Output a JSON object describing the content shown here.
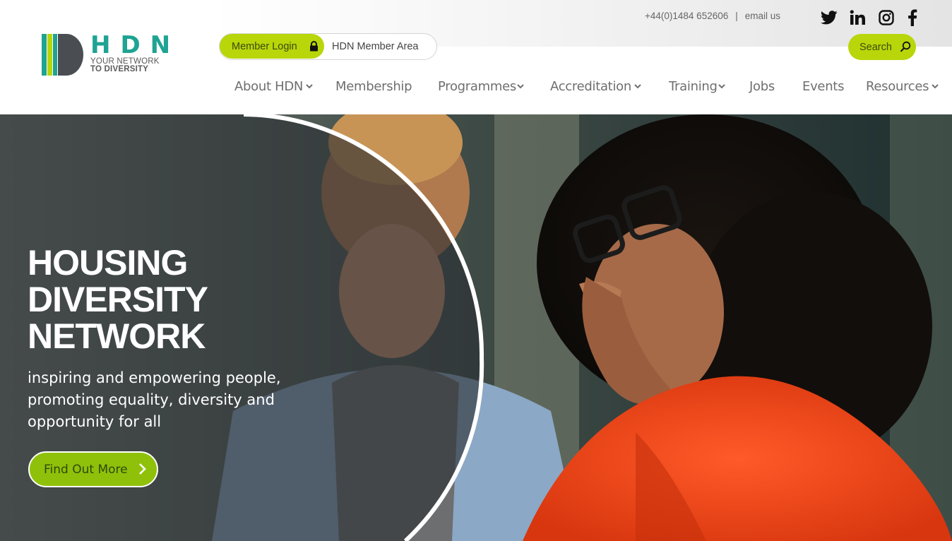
{
  "brand": {
    "letters": "HDN",
    "tagline_line1": "YOUR NETWORK",
    "tagline_line2": "TO DIVERSITY"
  },
  "topbar": {
    "phone": "+44(0)1484 652606",
    "separator": "|",
    "email": "email us",
    "socials": [
      "twitter-icon",
      "linkedin-icon",
      "instagram-icon",
      "facebook-icon"
    ]
  },
  "member": {
    "login_label": "Member Login",
    "area_label": "HDN Member Area"
  },
  "search": {
    "label": "Search"
  },
  "nav": {
    "items": [
      {
        "label": "About HDN",
        "dropdown": true
      },
      {
        "label": "Membership",
        "dropdown": false
      },
      {
        "label": "Programmes",
        "dropdown": true
      },
      {
        "label": "Accreditation",
        "dropdown": true
      },
      {
        "label": "Training",
        "dropdown": true
      },
      {
        "label": "Jobs",
        "dropdown": false
      },
      {
        "label": "Events",
        "dropdown": false
      },
      {
        "label": "Resources",
        "dropdown": true
      }
    ]
  },
  "hero": {
    "title_line1": "HOUSING",
    "title_line2": "DIVERSITY",
    "title_line3": "NETWORK",
    "sub_line1": "inspiring and empowering people,",
    "sub_line2": "promoting equality, diversity and",
    "sub_line3": "opportunity for all",
    "cta_label": "Find Out More"
  },
  "colors": {
    "accent_lime": "#b8d60a",
    "cta_green": "#8fc10b",
    "brand_teal": "#1fa392",
    "nav_text": "#6f6f6f"
  }
}
